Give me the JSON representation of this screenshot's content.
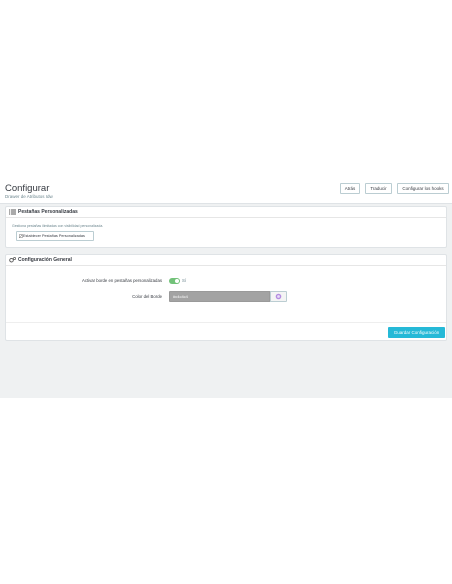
{
  "header": {
    "title": "Configurar",
    "subtitle": "Drawer de Atributos Idw"
  },
  "toolbar": {
    "back_label": "Atrás",
    "translate_label": "Traducir",
    "hooks_label": "Configurar los hooks"
  },
  "tabs_panel": {
    "title": "Pestañas Personalizadas",
    "icon": "list-icon",
    "description": "Gestiona pestañas ilimitadas con visibilidad personalizada.",
    "button_label": "Establecer Pestañas Personalizadas",
    "button_icon": "edit-icon"
  },
  "general_panel": {
    "title": "Configuración General",
    "icon": "cogs-icon",
    "border_toggle": {
      "label": "Activar borde en pestañas personalizadas",
      "value_label": "Sí",
      "enabled": true
    },
    "border_color": {
      "label": "Color del Borde",
      "value": "#c4c4c4"
    },
    "save_label": "Guardar Configuración"
  },
  "colors": {
    "accent": "#25b9d7",
    "switch_on": "#72c279",
    "background": "#eff1f2"
  }
}
